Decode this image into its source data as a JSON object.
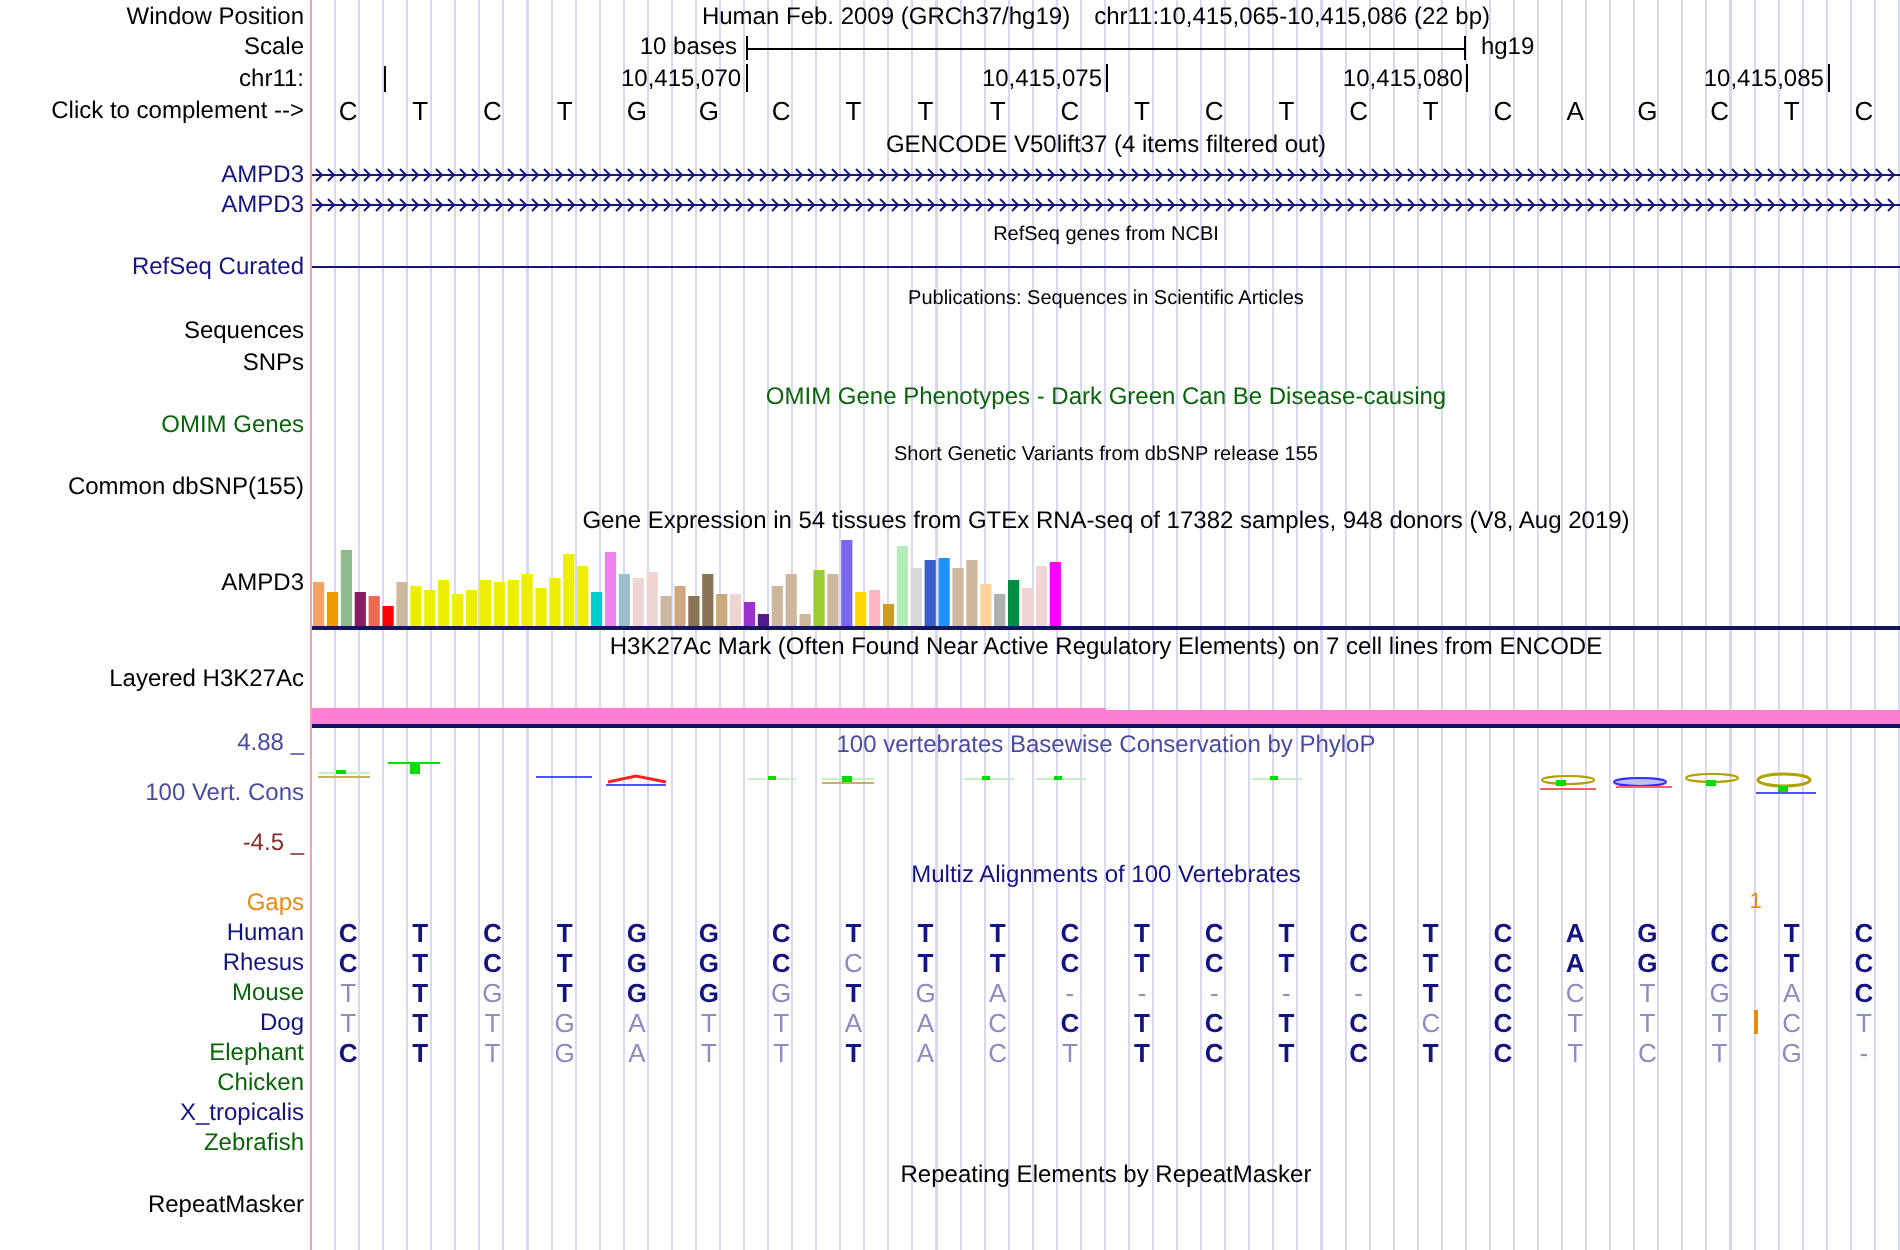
{
  "header": {
    "label": "Window Position",
    "assembly": "Human Feb. 2009 (GRCh37/hg19)",
    "position": "chr11:10,415,065-10,415,086 (22 bp)"
  },
  "scale": {
    "label": "Scale",
    "length": "10 bases",
    "genome": "hg19"
  },
  "ruler": {
    "label": "chr11:",
    "ticks": [
      "10,415,070",
      "10,415,075",
      "10,415,080",
      "10,415,085"
    ]
  },
  "sequence": {
    "label": "Click to complement -->",
    "bases": [
      "C",
      "T",
      "C",
      "T",
      "G",
      "G",
      "C",
      "T",
      "T",
      "T",
      "C",
      "T",
      "C",
      "T",
      "C",
      "T",
      "C",
      "A",
      "G",
      "C",
      "T",
      "C"
    ]
  },
  "tracks": [
    {
      "kind": "genes",
      "title": "GENCODE V50lift37 (4 items filtered out)",
      "color": "#141480",
      "items": [
        {
          "label": "AMPD3"
        },
        {
          "label": "AMPD3"
        }
      ]
    },
    {
      "kind": "line",
      "title": "RefSeq genes from NCBI",
      "label": "RefSeq Curated",
      "color": "#141480"
    },
    {
      "kind": "list",
      "title": "Publications: Sequences in Scientific Articles",
      "labels": [
        "Sequences",
        "SNPs"
      ]
    },
    {
      "kind": "annotation",
      "title": "OMIM Gene Phenotypes - Dark Green Can Be Disease-causing",
      "label": "OMIM Genes",
      "color": "#0a640a"
    },
    {
      "kind": "variants",
      "title": "Short Genetic Variants from dbSNP release 155",
      "label": "Common dbSNP(155)",
      "color": "#000000"
    },
    {
      "kind": "expression",
      "title": "Gene Expression in 54 tissues from GTEx RNA-seq of 17382 samples, 948 donors (V8, Aug 2019)",
      "label": "AMPD3",
      "color": "#000000"
    },
    {
      "kind": "signal",
      "title": "H3K27Ac Mark (Often Found Near Active Regulatory Elements) on 7 cell lines from ENCODE",
      "label": "Layered H3K27Ac",
      "color": "#000000"
    },
    {
      "kind": "conservation",
      "title": "100 vertebrates Basewise Conservation by PhyloP",
      "label": "100 Vert. Cons",
      "color": "#4a4aa0",
      "max": "4.88 _",
      "min": "-4.5 _"
    },
    {
      "kind": "multiz",
      "title": "Multiz Alignments of 100 Vertebrates",
      "color": "#141480",
      "gaps": {
        "label": "Gaps",
        "count": "1"
      },
      "rows": [
        {
          "species": "Human",
          "color": "#141480",
          "bases": [
            "C",
            "T",
            "C",
            "T",
            "G",
            "G",
            "C",
            "T",
            "T",
            "T",
            "C",
            "T",
            "C",
            "T",
            "C",
            "T",
            "C",
            "A",
            "G",
            "C",
            "T",
            "C"
          ],
          "conserved": [
            true,
            true,
            true,
            true,
            true,
            true,
            true,
            true,
            true,
            true,
            true,
            true,
            true,
            true,
            true,
            true,
            true,
            true,
            true,
            true,
            true,
            true
          ]
        },
        {
          "species": "Rhesus",
          "color": "#141480",
          "bases": [
            "C",
            "T",
            "C",
            "T",
            "G",
            "G",
            "C",
            "C",
            "T",
            "T",
            "C",
            "T",
            "C",
            "T",
            "C",
            "T",
            "C",
            "A",
            "G",
            "C",
            "T",
            "C"
          ],
          "conserved": [
            true,
            true,
            true,
            true,
            true,
            true,
            true,
            false,
            true,
            true,
            true,
            true,
            true,
            true,
            true,
            true,
            true,
            true,
            true,
            true,
            true,
            true
          ]
        },
        {
          "species": "Mouse",
          "color": "#0a640a",
          "bases": [
            "T",
            "T",
            "G",
            "T",
            "G",
            "G",
            "G",
            "T",
            "G",
            "A",
            "-",
            "-",
            "-",
            "-",
            "-",
            "T",
            "C",
            "C",
            "T",
            "G",
            "A",
            "C"
          ],
          "conserved": [
            false,
            true,
            false,
            true,
            true,
            true,
            false,
            true,
            false,
            false,
            false,
            false,
            false,
            false,
            false,
            true,
            true,
            false,
            false,
            false,
            false,
            true
          ]
        },
        {
          "species": "Dog",
          "color": "#141480",
          "bases": [
            "T",
            "T",
            "T",
            "G",
            "A",
            "T",
            "T",
            "A",
            "A",
            "C",
            "C",
            "T",
            "C",
            "T",
            "C",
            "C",
            "C",
            "T",
            "T",
            "T",
            "C",
            "T"
          ],
          "conserved": [
            false,
            true,
            false,
            false,
            false,
            false,
            false,
            false,
            false,
            false,
            true,
            true,
            true,
            true,
            true,
            false,
            true,
            false,
            false,
            false,
            false,
            false
          ],
          "insertions": [
            false,
            false,
            false,
            false,
            false,
            false,
            false,
            false,
            false,
            false,
            false,
            false,
            false,
            false,
            false,
            false,
            false,
            false,
            false,
            true,
            false,
            false
          ]
        },
        {
          "species": "Elephant",
          "color": "#0a640a",
          "bases": [
            "C",
            "T",
            "T",
            "G",
            "A",
            "T",
            "T",
            "T",
            "A",
            "C",
            "T",
            "T",
            "C",
            "T",
            "C",
            "T",
            "C",
            "T",
            "C",
            "T",
            "G",
            "-"
          ],
          "conserved": [
            true,
            true,
            false,
            false,
            false,
            false,
            false,
            true,
            false,
            false,
            false,
            true,
            true,
            true,
            true,
            true,
            true,
            false,
            false,
            false,
            false,
            false
          ]
        },
        {
          "species": "Chicken",
          "color": "#0a640a"
        },
        {
          "species": "X_tropicalis",
          "color": "#141480"
        },
        {
          "species": "Zebrafish",
          "color": "#0a640a"
        }
      ]
    },
    {
      "kind": "repeats",
      "title": "Repeating Elements by RepeatMasker",
      "label": "RepeatMasker",
      "color": "#000000"
    }
  ]
}
